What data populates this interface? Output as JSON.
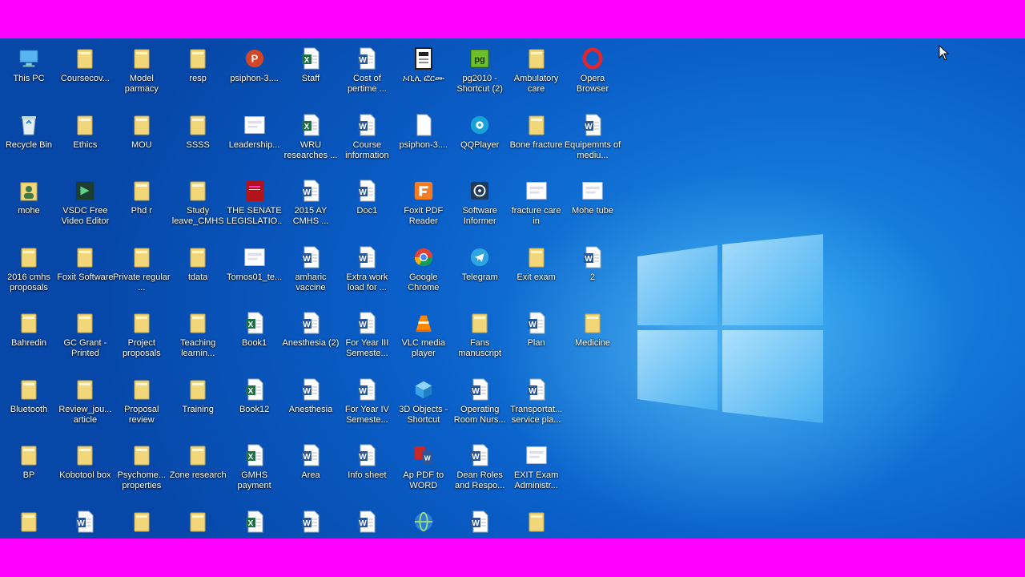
{
  "colors": {
    "frame_bar": "#ff00ff",
    "folder": "#f2d77a",
    "word": "#2b579a",
    "excel": "#1e7145"
  },
  "desktop": {
    "icons": [
      {
        "label": "This PC",
        "type": "monitor-icon",
        "col": 0,
        "row": 0
      },
      {
        "label": "Coursecov...",
        "type": "folder-icon",
        "col": 1,
        "row": 0
      },
      {
        "label": "Model parmacy",
        "type": "folder-icon",
        "col": 2,
        "row": 0
      },
      {
        "label": "resp",
        "type": "folder-icon",
        "col": 3,
        "row": 0
      },
      {
        "label": "psiphon-3....",
        "type": "psiphon-icon",
        "col": 4,
        "row": 0
      },
      {
        "label": "Staff",
        "type": "excel-icon",
        "col": 5,
        "row": 0
      },
      {
        "label": "Cost of pertime ...",
        "type": "word-icon",
        "col": 6,
        "row": 0
      },
      {
        "label": "ኦቢሊ ፎርሙ",
        "type": "document-icon",
        "col": 7,
        "row": 0
      },
      {
        "label": "pg2010 - Shortcut (2)",
        "type": "pg-shortcut-icon",
        "col": 8,
        "row": 0
      },
      {
        "label": "Ambulatory care",
        "type": "folder-icon",
        "col": 9,
        "row": 0
      },
      {
        "label": "Opera Browser",
        "type": "opera-icon",
        "col": 10,
        "row": 0
      },
      {
        "label": "Recycle Bin",
        "type": "recycle-bin-icon",
        "col": 0,
        "row": 1
      },
      {
        "label": "Ethics",
        "type": "folder-icon",
        "col": 1,
        "row": 1
      },
      {
        "label": "MOU",
        "type": "folder-icon",
        "col": 2,
        "row": 1
      },
      {
        "label": "SSSS",
        "type": "folder-icon",
        "col": 3,
        "row": 1
      },
      {
        "label": "Leadership...",
        "type": "image-icon",
        "col": 4,
        "row": 1
      },
      {
        "label": "WRU researches ...",
        "type": "excel-icon",
        "col": 5,
        "row": 1
      },
      {
        "label": "Course information",
        "type": "word-icon",
        "col": 6,
        "row": 1
      },
      {
        "label": "psiphon-3....",
        "type": "blank-file-icon",
        "col": 7,
        "row": 1
      },
      {
        "label": "QQPlayer",
        "type": "qqplayer-icon",
        "col": 8,
        "row": 1
      },
      {
        "label": "Bone fracture",
        "type": "folder-icon",
        "col": 9,
        "row": 1
      },
      {
        "label": "Equipemnts of mediu...",
        "type": "word-icon",
        "col": 10,
        "row": 1
      },
      {
        "label": "mohe",
        "type": "user-folder-icon",
        "col": 0,
        "row": 2
      },
      {
        "label": "VSDC Free Video Editor",
        "type": "vsdc-icon",
        "col": 1,
        "row": 2
      },
      {
        "label": "Phd r",
        "type": "folder-icon",
        "col": 2,
        "row": 2
      },
      {
        "label": "Study leave_CMHS",
        "type": "folder-icon",
        "col": 3,
        "row": 2
      },
      {
        "label": "THE SENATE LEGISLATIO...",
        "type": "red-book-icon",
        "col": 4,
        "row": 2
      },
      {
        "label": "2015 AY CMHS ...",
        "type": "word-icon",
        "col": 5,
        "row": 2
      },
      {
        "label": "Doc1",
        "type": "word-icon",
        "col": 6,
        "row": 2
      },
      {
        "label": "Foxit PDF Reader",
        "type": "foxit-icon",
        "col": 7,
        "row": 2
      },
      {
        "label": "Software Informer",
        "type": "software-informer-icon",
        "col": 8,
        "row": 2
      },
      {
        "label": "fracture care in",
        "type": "image-icon",
        "col": 9,
        "row": 2
      },
      {
        "label": "Mohe tube",
        "type": "image-icon",
        "col": 10,
        "row": 2
      },
      {
        "label": "2016 cmhs proposals",
        "type": "folder-icon",
        "col": 0,
        "row": 3
      },
      {
        "label": "Foxit Software",
        "type": "folder-icon",
        "col": 1,
        "row": 3
      },
      {
        "label": "Private regular ...",
        "type": "folder-icon",
        "col": 2,
        "row": 3
      },
      {
        "label": "tdata",
        "type": "folder-icon",
        "col": 3,
        "row": 3
      },
      {
        "label": "Tomos01_te...",
        "type": "image-icon",
        "col": 4,
        "row": 3
      },
      {
        "label": "amharic vaccine",
        "type": "word-icon",
        "col": 5,
        "row": 3
      },
      {
        "label": "Extra work load for ...",
        "type": "word-icon",
        "col": 6,
        "row": 3
      },
      {
        "label": "Google Chrome",
        "type": "chrome-icon",
        "col": 7,
        "row": 3
      },
      {
        "label": "Telegram",
        "type": "telegram-icon",
        "col": 8,
        "row": 3
      },
      {
        "label": "Exit exam",
        "type": "folder-icon",
        "col": 9,
        "row": 3
      },
      {
        "label": "2",
        "type": "word-icon",
        "col": 10,
        "row": 3
      },
      {
        "label": "Bahredin",
        "type": "folder-icon",
        "col": 0,
        "row": 4
      },
      {
        "label": "GC Grant - Printed",
        "type": "folder-icon",
        "col": 1,
        "row": 4
      },
      {
        "label": "Project proposals",
        "type": "folder-icon",
        "col": 2,
        "row": 4
      },
      {
        "label": "Teaching learnin...",
        "type": "folder-icon",
        "col": 3,
        "row": 4
      },
      {
        "label": "Book1",
        "type": "excel-icon",
        "col": 4,
        "row": 4
      },
      {
        "label": "Anesthesia (2)",
        "type": "word-icon",
        "col": 5,
        "row": 4
      },
      {
        "label": "For Year III Semeste...",
        "type": "word-icon",
        "col": 6,
        "row": 4
      },
      {
        "label": "VLC media player",
        "type": "vlc-icon",
        "col": 7,
        "row": 4
      },
      {
        "label": "Fans manuscript",
        "type": "folder-icon",
        "col": 8,
        "row": 4
      },
      {
        "label": "Plan",
        "type": "word-icon",
        "col": 9,
        "row": 4
      },
      {
        "label": "Medicine",
        "type": "folder-icon",
        "col": 10,
        "row": 4
      },
      {
        "label": "Bluetooth",
        "type": "folder-icon",
        "col": 0,
        "row": 5
      },
      {
        "label": "Review_jou... article",
        "type": "folder-icon",
        "col": 1,
        "row": 5
      },
      {
        "label": "Proposal review",
        "type": "folder-icon",
        "col": 2,
        "row": 5
      },
      {
        "label": "Training",
        "type": "folder-icon",
        "col": 3,
        "row": 5
      },
      {
        "label": "Book12",
        "type": "excel-icon",
        "col": 4,
        "row": 5
      },
      {
        "label": "Anesthesia",
        "type": "word-icon",
        "col": 5,
        "row": 5
      },
      {
        "label": "For Year IV Semeste...",
        "type": "word-icon",
        "col": 6,
        "row": 5
      },
      {
        "label": "3D Objects - Shortcut",
        "type": "3d-objects-icon",
        "col": 7,
        "row": 5
      },
      {
        "label": "Operating Room Nurs...",
        "type": "word-icon",
        "col": 8,
        "row": 5
      },
      {
        "label": "Transportat... service pla...",
        "type": "word-icon",
        "col": 9,
        "row": 5
      },
      {
        "label": "BP",
        "type": "folder-icon",
        "col": 0,
        "row": 6
      },
      {
        "label": "Kobotool box",
        "type": "folder-icon",
        "col": 1,
        "row": 6
      },
      {
        "label": "Psychome... properties",
        "type": "folder-icon",
        "col": 2,
        "row": 6
      },
      {
        "label": "Zone research",
        "type": "folder-icon",
        "col": 3,
        "row": 6
      },
      {
        "label": "GMHS payment",
        "type": "excel-icon",
        "col": 4,
        "row": 6
      },
      {
        "label": "Area",
        "type": "word-icon",
        "col": 5,
        "row": 6
      },
      {
        "label": "Info sheet",
        "type": "word-icon",
        "col": 6,
        "row": 6
      },
      {
        "label": "Ap PDF to WORD",
        "type": "pdf-to-word-icon",
        "col": 7,
        "row": 6
      },
      {
        "label": "Dean Roles and Respo...",
        "type": "word-icon",
        "col": 8,
        "row": 6
      },
      {
        "label": "EXIT Exam Administr...",
        "type": "image-icon",
        "col": 9,
        "row": 6
      },
      {
        "label": "",
        "type": "folder-icon",
        "col": 0,
        "row": 7
      },
      {
        "label": "",
        "type": "word-icon",
        "col": 1,
        "row": 7
      },
      {
        "label": "",
        "type": "folder-icon",
        "col": 2,
        "row": 7
      },
      {
        "label": "",
        "type": "folder-icon",
        "col": 3,
        "row": 7
      },
      {
        "label": "",
        "type": "excel-icon",
        "col": 4,
        "row": 7
      },
      {
        "label": "",
        "type": "word-icon",
        "col": 5,
        "row": 7
      },
      {
        "label": "",
        "type": "word-icon",
        "col": 6,
        "row": 7
      },
      {
        "label": "",
        "type": "globe-icon",
        "col": 7,
        "row": 7
      },
      {
        "label": "",
        "type": "word-icon",
        "col": 8,
        "row": 7
      },
      {
        "label": "",
        "type": "folder-icon",
        "col": 9,
        "row": 7
      }
    ]
  }
}
